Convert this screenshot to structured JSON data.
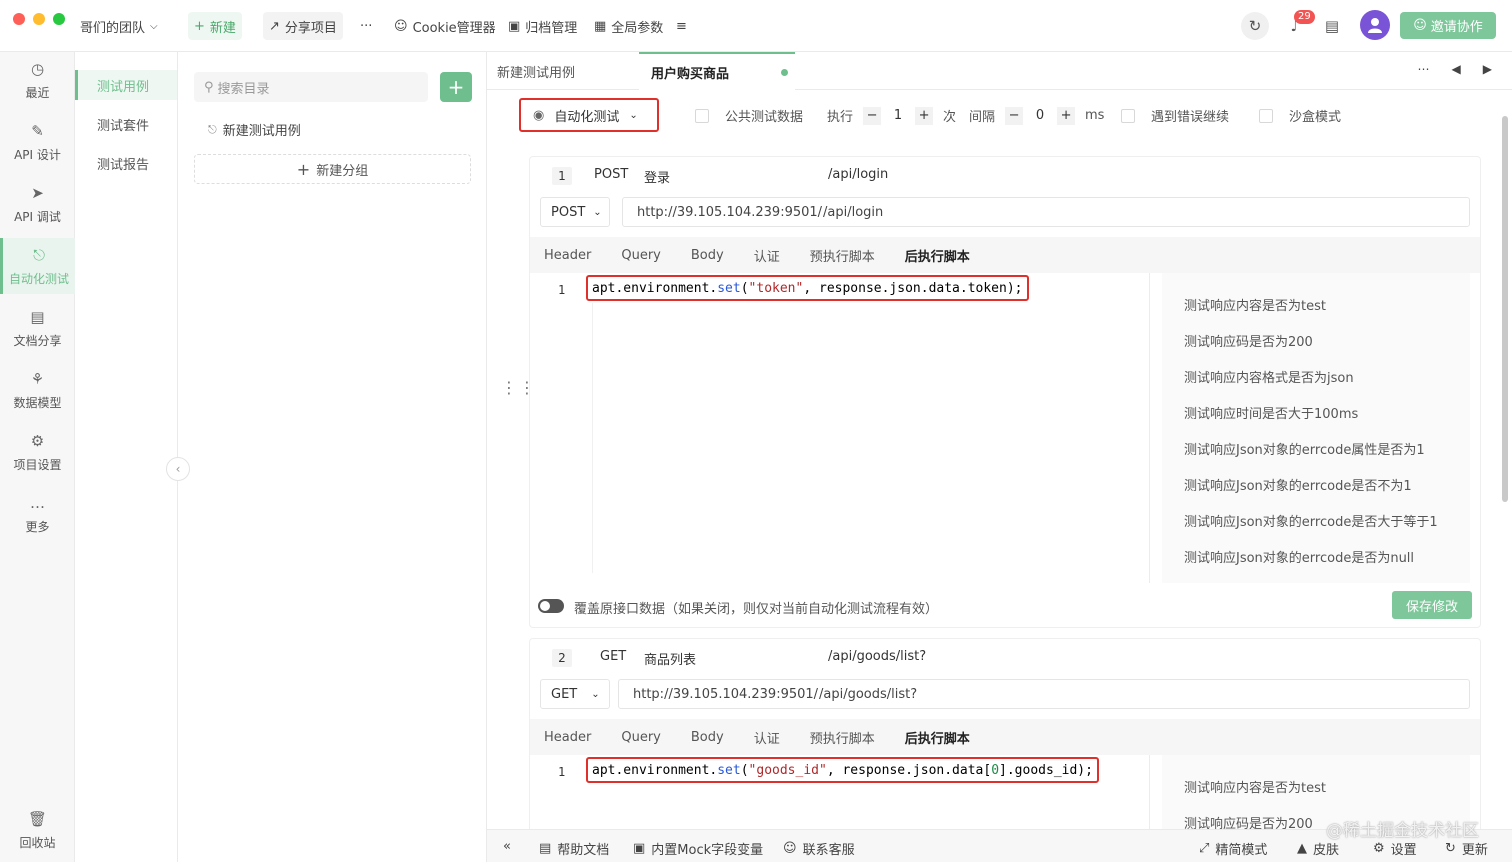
{
  "colors": {
    "accent": "#6fbf8e",
    "highlight": "#e0302b",
    "badge": "#f25353",
    "avatar": "#7a54d6"
  },
  "titlebar": {
    "team": "哥们的团队",
    "new_label": "新建",
    "share_label": "分享项目",
    "more": "···",
    "cookie_label": "Cookie管理器",
    "archive_label": "归档管理",
    "global_params_label": "全局参数",
    "notification_count": "29",
    "invite_label": "邀请协作"
  },
  "left_nav": {
    "recent": "最近",
    "api_design": "API 设计",
    "api_debug": "API 调试",
    "auto_test": "自动化测试",
    "doc_share": "文档分享",
    "data_model": "数据模型",
    "project_settings": "项目设置",
    "more": "更多",
    "recycle": "回收站"
  },
  "sub_nav": {
    "cases": "测试用例",
    "suites": "测试套件",
    "reports": "测试报告"
  },
  "tree": {
    "search_placeholder": "搜索目录",
    "case_item": "新建测试用例",
    "new_group": "新建分组"
  },
  "tabs": {
    "tab1": "新建测试用例",
    "tab2": "用户购买商品"
  },
  "toolbar": {
    "mode": "自动化测试",
    "public_data": "公共测试数据",
    "execute": "执行",
    "execute_value": "1",
    "times": "次",
    "interval": "间隔",
    "interval_value": "0",
    "ms": "ms",
    "continue_on_error": "遇到错误继续",
    "sandbox": "沙盒模式"
  },
  "step_tabs": {
    "header": "Header",
    "query": "Query",
    "body": "Body",
    "auth": "认证",
    "pre_script": "预执行脚本",
    "post_script": "后执行脚本"
  },
  "step1": {
    "num": "1",
    "method": "POST",
    "name": "登录",
    "path": "/api/login",
    "host": "http://39.105.104.239:9501/",
    "line": "1",
    "code_a": "apt.environment.",
    "code_fn": "set",
    "code_b": "(",
    "code_str": "\"token\"",
    "code_c": ", response.json.data.token);",
    "snippets": [
      "测试响应内容是否为test",
      "测试响应码是否为200",
      "测试响应内容格式是否为json",
      "测试响应时间是否大于100ms",
      "测试响应Json对象的errcode属性是否为1",
      "测试响应Json对象的errcode是否不为1",
      "测试响应Json对象的errcode是否大于等于1",
      "测试响应Json对象的errcode是否为null"
    ],
    "override_text": "覆盖原接口数据（如果关闭，则仅对当前自动化测试流程有效）",
    "save_label": "保存修改"
  },
  "step2": {
    "num": "2",
    "method": "GET",
    "name": "商品列表",
    "path": "/api/goods/list?",
    "host": "http://39.105.104.239:9501/",
    "line": "1",
    "code_a": "apt.environment.",
    "code_fn": "set",
    "code_b": "(",
    "code_str": "\"goods_id\"",
    "code_c": ", response.json.data[",
    "code_num": "0",
    "code_d": "].goods_id);",
    "snippets": [
      "测试响应内容是否为test",
      "测试响应码是否为200"
    ]
  },
  "footer": {
    "help": "帮助文档",
    "mock": "内置Mock字段变量",
    "support": "联系客服",
    "simple_mode": "精简模式",
    "skin": "皮肤",
    "settings": "设置",
    "update": "更新"
  },
  "watermark": "@稀土掘金技术社区"
}
